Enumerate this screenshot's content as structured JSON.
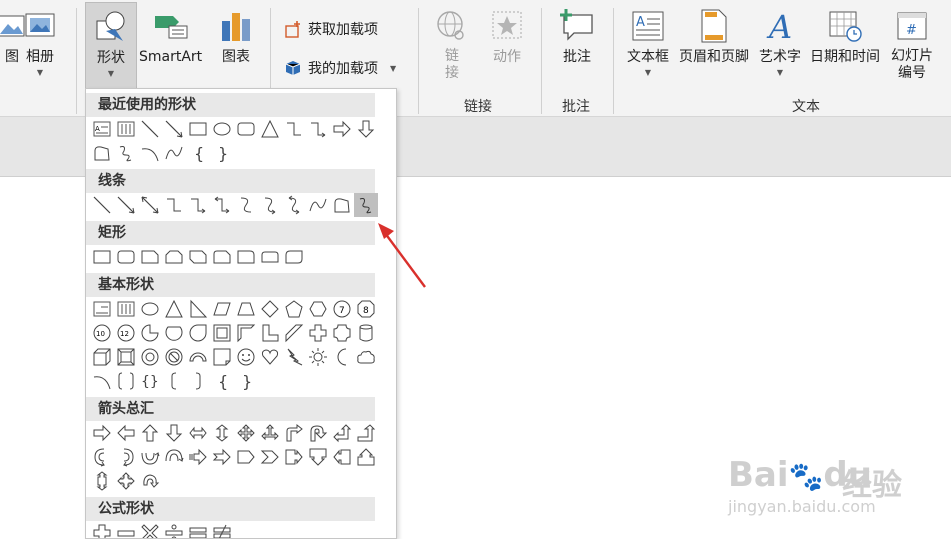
{
  "ribbon": {
    "partial_left_label": "图",
    "album": "相册",
    "shapes": "形状",
    "smartart": "SmartArt",
    "chart": "图表",
    "get_addins": "获取加载项",
    "my_addins": "我的加载项",
    "link": "链\n接",
    "action": "动作",
    "comment": "批注",
    "textbox": "文本框",
    "header_footer": "页眉和页脚",
    "wordart": "艺术字",
    "datetime": "日期和时间",
    "slide_number_line1": "幻灯片",
    "slide_number_line2": "编号",
    "groups": {
      "links": "链接",
      "comments": "批注",
      "text": "文本"
    }
  },
  "shapes_menu": {
    "sections": [
      {
        "title": "最近使用的形状"
      },
      {
        "title": "线条"
      },
      {
        "title": "矩形"
      },
      {
        "title": "基本形状"
      },
      {
        "title": "箭头总汇"
      },
      {
        "title": "公式形状"
      }
    ],
    "selected_shape": "freeform-scribble"
  },
  "watermark": {
    "brand": "Bai",
    "brand_tail": "du",
    "cn": "经验",
    "url": "jingyan.baidu.com"
  },
  "colors": {
    "annotation_arrow": "#d9302c",
    "ribbon_bg": "#f3f3f3",
    "accent_blue": "#2f6db5",
    "addin_orange": "#d35b2a"
  }
}
